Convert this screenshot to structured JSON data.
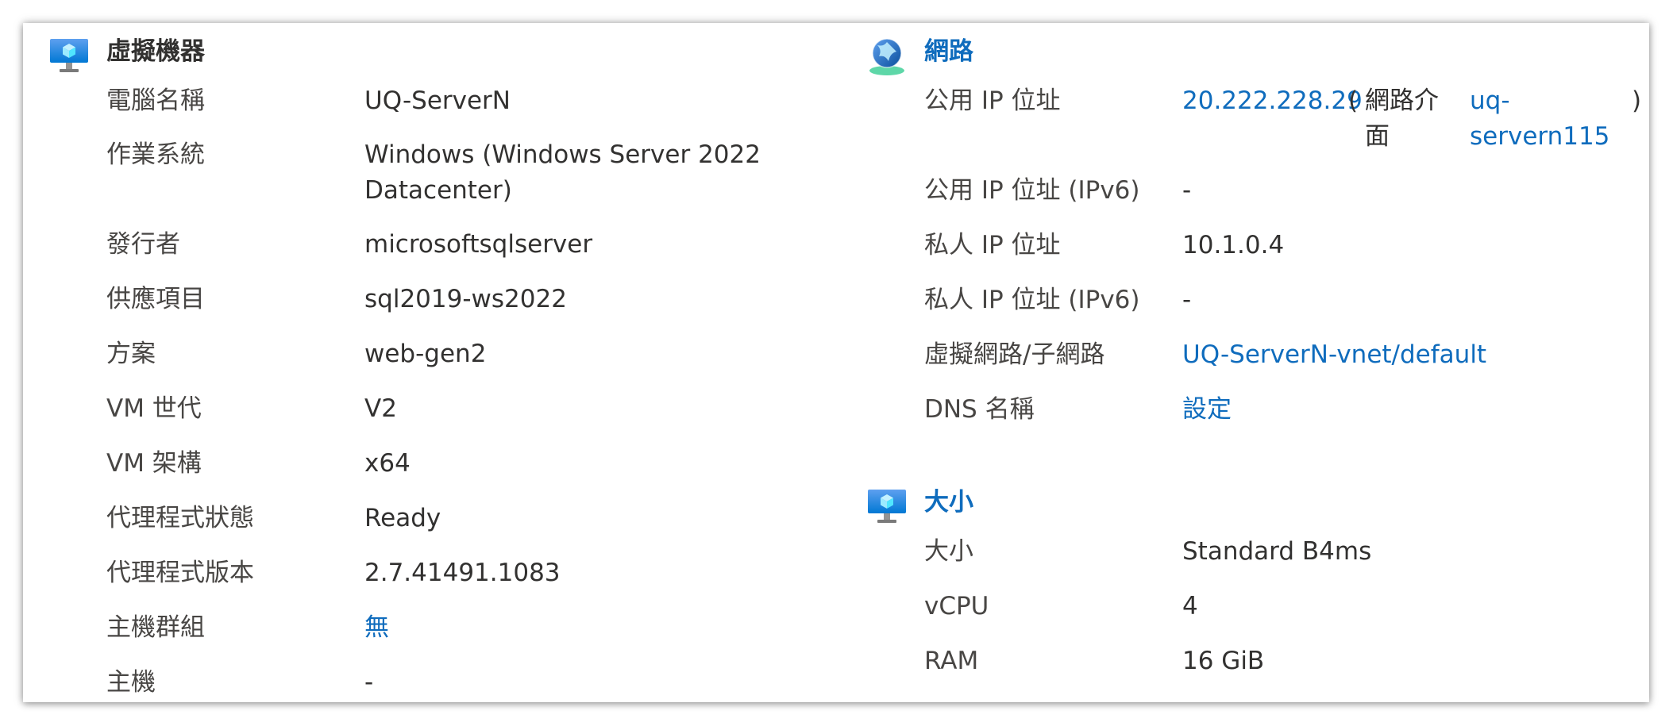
{
  "vm_section": {
    "title": "虛擬機器",
    "icon": "vm-monitor-icon",
    "rows": [
      {
        "label": "電腦名稱",
        "value": "UQ-ServerN"
      },
      {
        "label": "作業系統",
        "value_line1": "Windows (Windows Server 2022",
        "value_line2": "Datacenter)"
      },
      {
        "label": "發行者",
        "value": "microsoftsqlserver"
      },
      {
        "label": "供應項目",
        "value": "sql2019-ws2022"
      },
      {
        "label": "方案",
        "value": "web-gen2"
      },
      {
        "label": "VM 世代",
        "value": "V2"
      },
      {
        "label": "VM 架構",
        "value": "x64"
      },
      {
        "label": "代理程式狀態",
        "value": "Ready"
      },
      {
        "label": "代理程式版本",
        "value": "2.7.41491.1083"
      },
      {
        "label": "主機群組",
        "value": "無"
      },
      {
        "label": "主機",
        "value": "-"
      }
    ]
  },
  "network_section": {
    "title": "網路",
    "icon": "network-globe-icon",
    "public_ip": {
      "label": "公用 IP 位址",
      "ip": "20.222.228.29",
      "open_paren": "(",
      "nic_label_line1": "網路介",
      "nic_label_line2": "面",
      "nic_line1": "uq-",
      "nic_line2": "servern115",
      "close_paren": ")"
    },
    "rows": [
      {
        "label": "公用 IP 位址 (IPv6)",
        "value": "-"
      },
      {
        "label": "私人 IP 位址",
        "value": "10.1.0.4"
      },
      {
        "label": "私人 IP 位址 (IPv6)",
        "value": "-"
      },
      {
        "label": "虛擬網路/子網路",
        "value": "UQ-ServerN-vnet/default"
      },
      {
        "label": "DNS 名稱",
        "value": "設定"
      }
    ]
  },
  "size_section": {
    "title": "大小",
    "icon": "vm-monitor-icon",
    "rows": [
      {
        "label": "大小",
        "value": "Standard B4ms"
      },
      {
        "label": "vCPU",
        "value": "4"
      },
      {
        "label": "RAM",
        "value": "16 GiB"
      }
    ]
  },
  "colors": {
    "link": "#0f6cbd",
    "text": "#323130",
    "label": "#484644"
  }
}
